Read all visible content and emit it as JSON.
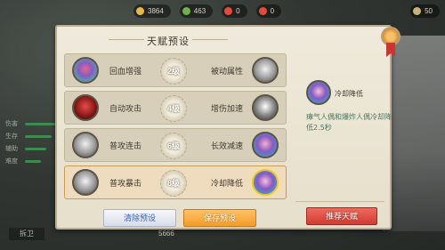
{
  "topbar": {
    "resources": [
      {
        "value": "3864",
        "color": "#e9b64a"
      },
      {
        "value": "463",
        "color": "#6fb24c"
      },
      {
        "value": "0",
        "color": "#e24c3b"
      },
      {
        "value": "0",
        "color": "#e24c3b"
      }
    ],
    "badge_value": "50"
  },
  "side_left": {
    "labels": [
      "伤害",
      "生存",
      "辅助",
      "难度"
    ]
  },
  "dialog": {
    "title": "天赋预设",
    "rows": [
      {
        "left_label": "回血增强",
        "level": "2级",
        "right_label": "被动属性",
        "active": false
      },
      {
        "left_label": "自动攻击",
        "level": "4级",
        "right_label": "增伤加速",
        "active": false
      },
      {
        "left_label": "普攻连击",
        "level": "6级",
        "right_label": "长效减速",
        "active": false
      },
      {
        "left_label": "普攻暴击",
        "level": "8级",
        "right_label": "冷却降低",
        "active": true
      }
    ],
    "detail": {
      "name": "冷却降低",
      "description": "瘴气人偶和爆炸人偶冷却降低2.5秒"
    },
    "buttons": {
      "clear": "清除预设",
      "save": "保存预设",
      "recommend": "推荐天赋"
    }
  },
  "bottom": {
    "left_label": "拆卫",
    "resource": "5666"
  },
  "colors": {
    "accent_orange": "#f29d2a",
    "accent_red": "#cf3c33",
    "accent_blue": "#3b62b8",
    "desc_green": "#4a7a63"
  }
}
